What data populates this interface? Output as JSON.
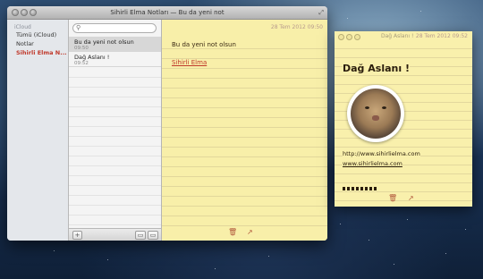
{
  "main_window": {
    "title": "Sihirli Elma Notları — Bu da yeni not",
    "sidebar": {
      "header": "iCloud",
      "items": [
        "Tümü (iCloud)",
        "Notlar",
        "Sihirli Elma N..."
      ]
    },
    "search": {
      "placeholder": ""
    },
    "notes": [
      {
        "title": "Bu da yeni not olsun",
        "time": "09:50"
      },
      {
        "title": "Dağ Aslanı !",
        "time": "09:52"
      }
    ],
    "editor": {
      "date": "28 Tem 2012 09:50",
      "line1": "Bu da yeni not olsun",
      "link": "Sihirli Elma"
    },
    "add_label": "+"
  },
  "floating_note": {
    "title": "Dağ Aslanı !",
    "date": "28 Tem 2012 09:52",
    "heading": "Dağ Aslanı !",
    "url_plain": "http://www.sihirlielma.com",
    "url_link": "www.sihirlielma.com"
  },
  "icons": [
    "search-icon",
    "trash-icon",
    "share-icon",
    "fullscreen-icon"
  ]
}
